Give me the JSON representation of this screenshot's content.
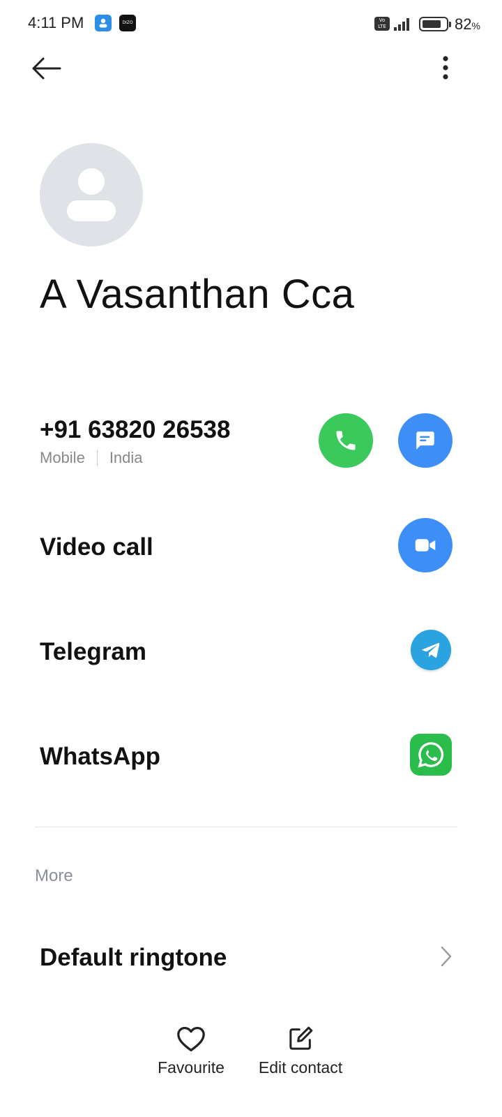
{
  "status_bar": {
    "time": "4:11 PM",
    "app_icon_2_text": "DIZO",
    "volte_text": "Vo LTE",
    "battery_percent": "82",
    "battery_unit": "%",
    "battery_level": 0.82
  },
  "contact": {
    "name": "A Vasanthan Cca",
    "phone": {
      "number": "+91 63820 26538",
      "type": "Mobile",
      "region": "India"
    }
  },
  "actions": {
    "video_call_label": "Video call",
    "telegram_label": "Telegram",
    "whatsapp_label": "WhatsApp"
  },
  "more_section": {
    "header": "More",
    "default_ringtone_label": "Default ringtone"
  },
  "bottom_bar": {
    "favourite_label": "Favourite",
    "edit_contact_label": "Edit contact"
  },
  "colors": {
    "call_green": "#3bc95c",
    "message_blue": "#3d8ff7",
    "telegram_blue": "#2aa3e0",
    "whatsapp_green": "#2bbd4c",
    "avatar_gray": "#dfe2e7"
  },
  "icons": [
    "contacts-app-icon",
    "dizo-app-icon",
    "volte-icon",
    "signal-icon",
    "battery-icon",
    "back-arrow-icon",
    "more-vertical-icon",
    "avatar-placeholder-icon",
    "phone-icon",
    "message-icon",
    "video-camera-icon",
    "telegram-icon",
    "whatsapp-icon",
    "chevron-right-icon",
    "heart-icon",
    "edit-icon"
  ]
}
